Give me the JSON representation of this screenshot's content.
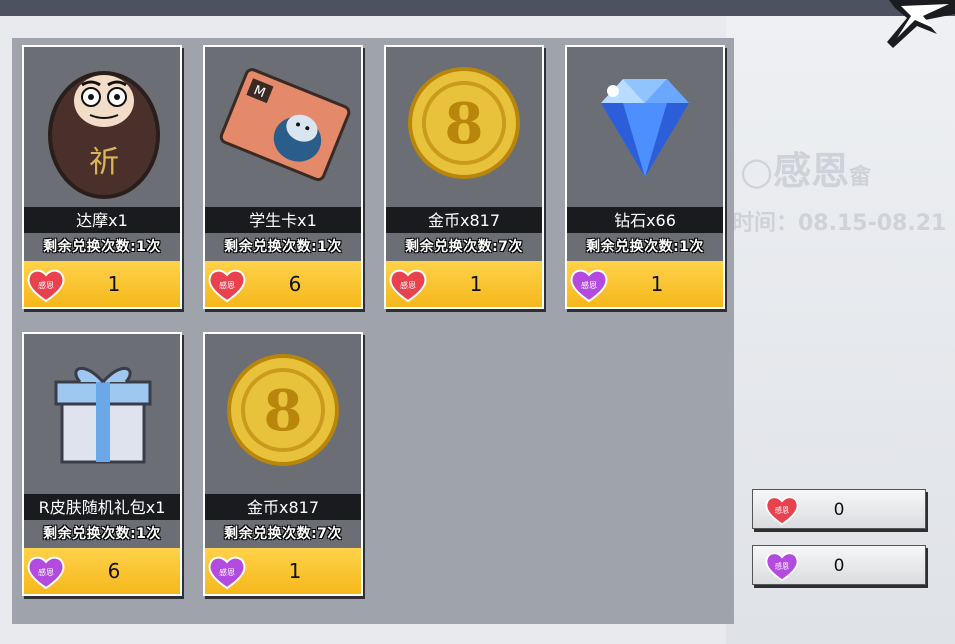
{
  "background": {
    "event_title": "○感恩",
    "event_title_tail": "畲",
    "event_time": "时间：08.15-08.21"
  },
  "currencies": {
    "red": {
      "icon": "red-heart-token-icon",
      "label": "感恩",
      "color": "#e8424f"
    },
    "purple": {
      "icon": "purple-heart-token-icon",
      "label": "感恩",
      "color": "#b44be0"
    }
  },
  "shop": {
    "items": [
      {
        "name": "达摩x1",
        "remaining": "剩余兑换次数:1次",
        "price": "1",
        "currency": "red",
        "icon": "daruma-icon"
      },
      {
        "name": "学生卡x1",
        "remaining": "剩余兑换次数:1次",
        "price": "6",
        "currency": "red",
        "icon": "student-card-icon"
      },
      {
        "name": "金币x817",
        "remaining": "剩余兑换次数:7次",
        "price": "1",
        "currency": "red",
        "icon": "gold-coin-icon"
      },
      {
        "name": "钻石x66",
        "remaining": "剩余兑换次数:1次",
        "price": "1",
        "currency": "purple",
        "icon": "diamond-icon"
      },
      {
        "name": "R皮肤随机礼包x1",
        "remaining": "剩余兑换次数:1次",
        "price": "6",
        "currency": "purple",
        "icon": "gift-box-icon"
      },
      {
        "name": "金币x817",
        "remaining": "剩余兑换次数:7次",
        "price": "1",
        "currency": "purple",
        "icon": "gold-coin-icon"
      }
    ]
  },
  "wallet": [
    {
      "currency": "red",
      "icon": "red-heart-token-icon",
      "amount": "0"
    },
    {
      "currency": "purple",
      "icon": "purple-heart-token-icon",
      "amount": "0"
    }
  ]
}
